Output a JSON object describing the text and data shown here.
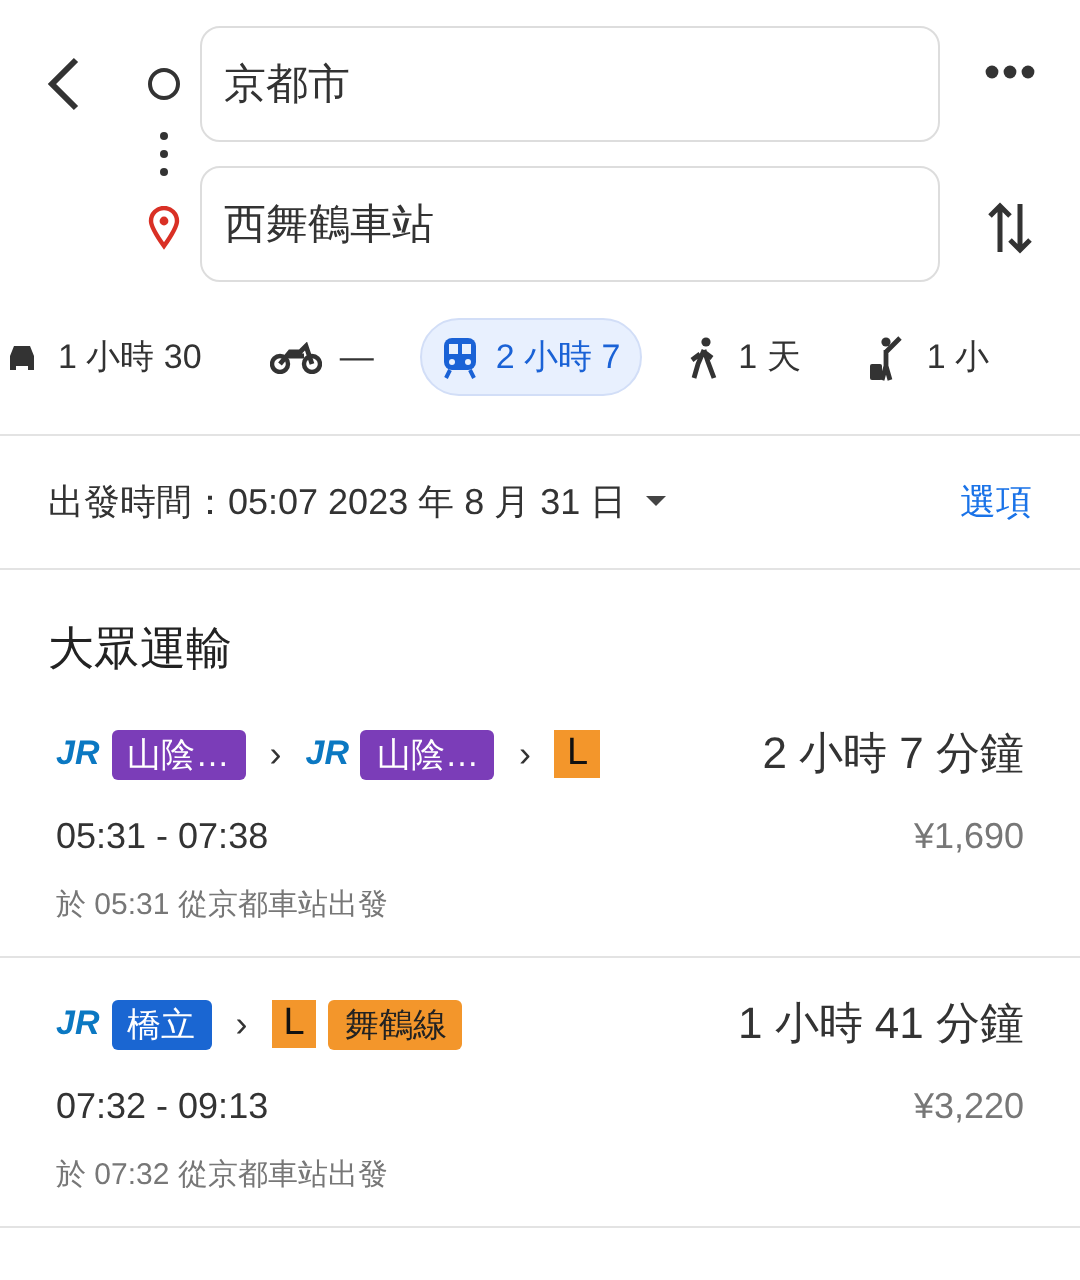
{
  "search": {
    "origin": "京都市",
    "destination": "西舞鶴車站"
  },
  "modes": [
    {
      "kind": "car",
      "label": "1 小時 30",
      "selected": false
    },
    {
      "kind": "motorcycle",
      "label": "—",
      "selected": false
    },
    {
      "kind": "transit",
      "label": "2 小時 7",
      "selected": true
    },
    {
      "kind": "walk",
      "label": "1 天",
      "selected": false
    },
    {
      "kind": "ride",
      "label": "1 小",
      "selected": false
    }
  ],
  "departure": {
    "label": "出發時間：05:07 2023 年 8 月 31 日",
    "options": "選項"
  },
  "section_title": "大眾運輸",
  "routes": [
    {
      "steps": [
        {
          "kind": "logo",
          "text": "JR"
        },
        {
          "kind": "line",
          "text": "山陰…",
          "color": "#7b3db8"
        },
        {
          "kind": "sep",
          "text": "›"
        },
        {
          "kind": "logo",
          "text": "JR"
        },
        {
          "kind": "line",
          "text": "山陰…",
          "color": "#7b3db8"
        },
        {
          "kind": "sep",
          "text": "›"
        },
        {
          "kind": "letter",
          "text": "L",
          "color": "#f3962b"
        }
      ],
      "duration": "2 小時 7 分鐘",
      "times": "05:31 - 07:38",
      "fare": "¥1,690",
      "note": "於 05:31 從京都車站出發"
    },
    {
      "steps": [
        {
          "kind": "logo",
          "text": "JR"
        },
        {
          "kind": "line",
          "text": "橋立",
          "color": "#1a66d2"
        },
        {
          "kind": "sep",
          "text": "›"
        },
        {
          "kind": "letter",
          "text": "L",
          "color": "#f3962b"
        },
        {
          "kind": "line",
          "text": "舞鶴線",
          "color": "#f3962b"
        }
      ],
      "duration": "1 小時 41 分鐘",
      "times": "07:32 - 09:13",
      "fare": "¥3,220",
      "note": "於 07:32 從京都車站出發"
    }
  ]
}
